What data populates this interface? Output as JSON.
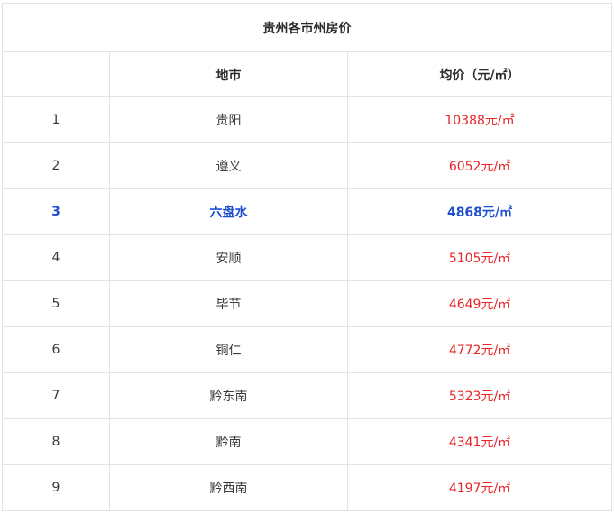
{
  "table": {
    "title": "贵州各市州房价",
    "headers": [
      "",
      "地市",
      "均价（元/㎡）"
    ],
    "rows": [
      {
        "index": "1",
        "city": "贵阳",
        "price": "10388元/㎡"
      },
      {
        "index": "2",
        "city": "遵义",
        "price": "6052元/㎡"
      },
      {
        "index": "3",
        "city": "六盘水",
        "price": "4868元/㎡",
        "highlight": true
      },
      {
        "index": "4",
        "city": "安顺",
        "price": "5105元/㎡"
      },
      {
        "index": "5",
        "city": "毕节",
        "price": "4649元/㎡"
      },
      {
        "index": "6",
        "city": "铜仁",
        "price": "4772元/㎡"
      },
      {
        "index": "7",
        "city": "黔东南",
        "price": "5323元/㎡"
      },
      {
        "index": "8",
        "city": "黔南",
        "price": "4341元/㎡"
      },
      {
        "index": "9",
        "city": "黔西南",
        "price": "4197元/㎡"
      }
    ]
  },
  "colors": {
    "price": "#e8262a",
    "highlight": "#1f4fd1",
    "border": "#e3e3e3"
  }
}
